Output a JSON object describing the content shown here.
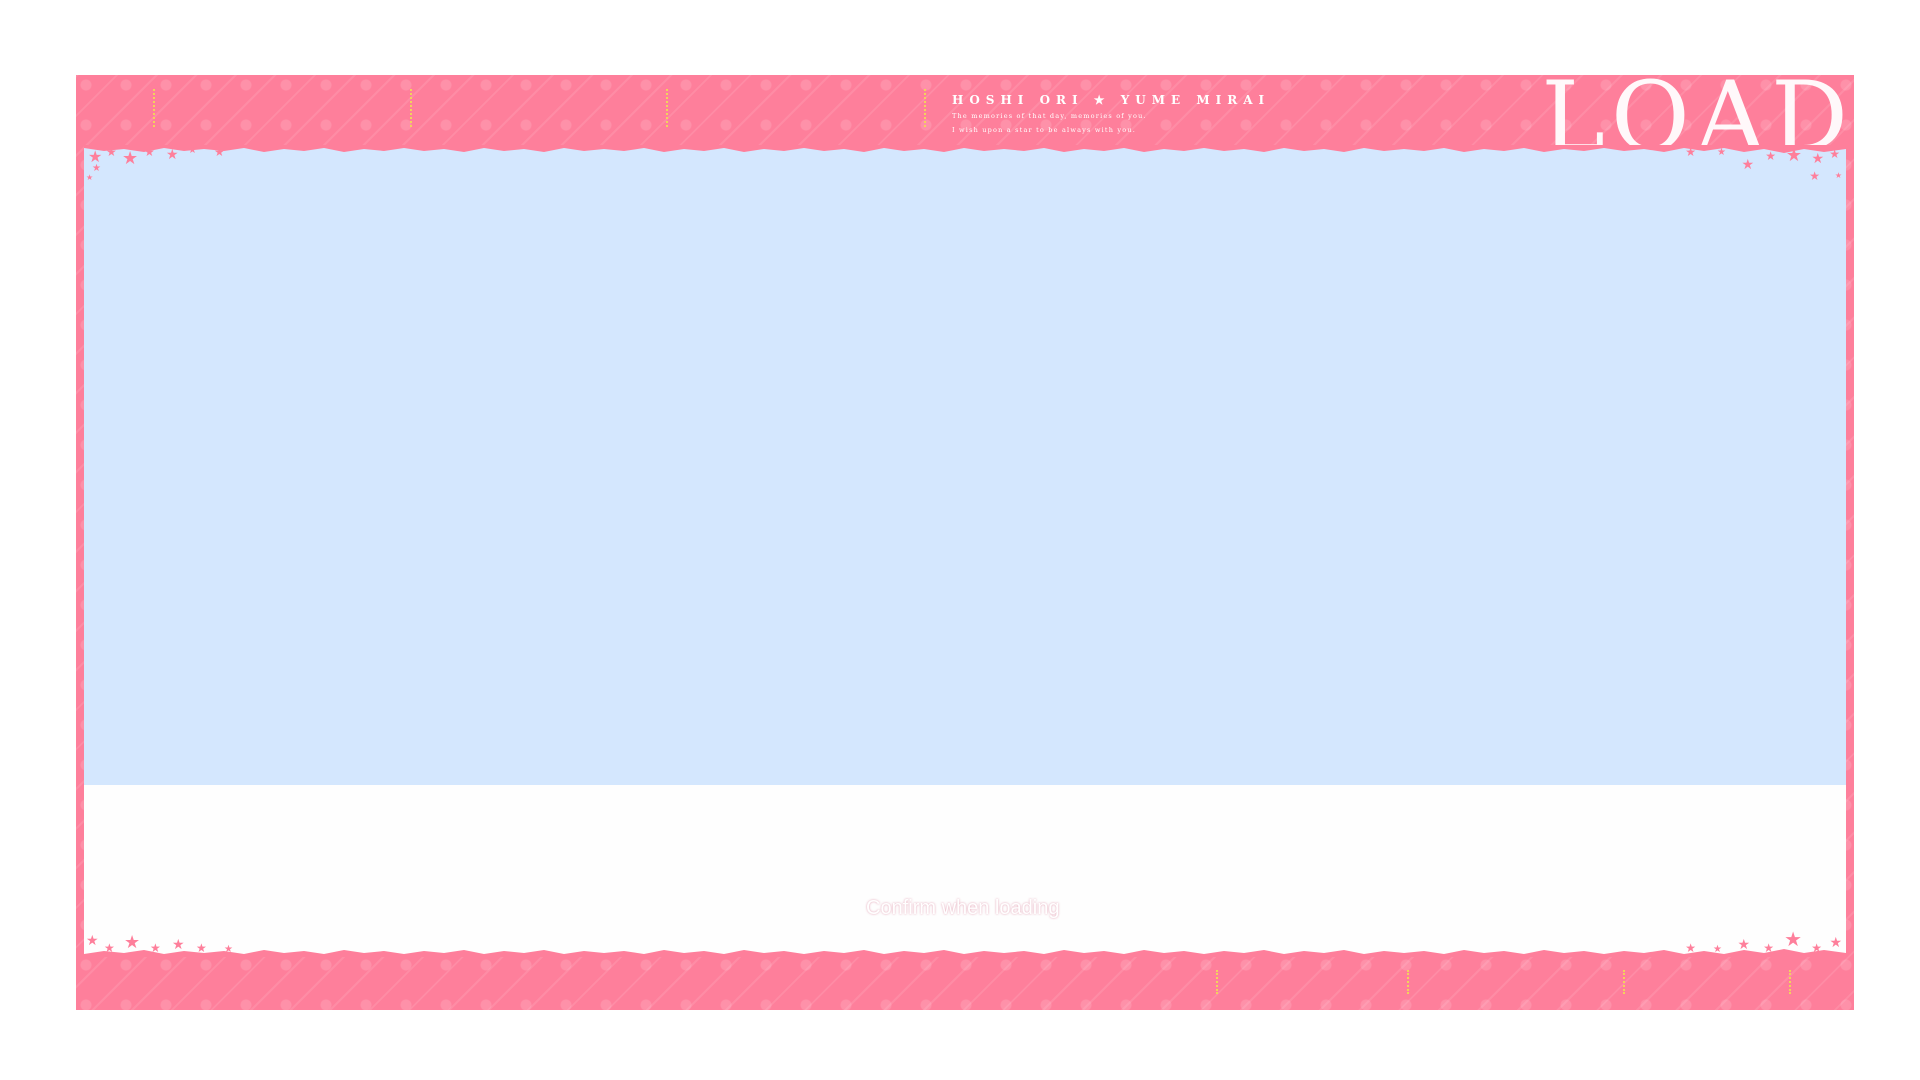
{
  "header": {
    "brand_title": "HOSHI ORI ★ YUME MIRAI",
    "brand_sub_1": "The memories of that day, memories of you.",
    "brand_sub_2": "I wish upon a star to be always with you.",
    "screen_title": "LOAD"
  },
  "footer": {
    "confirm_label": "Confirm when loading"
  },
  "colors": {
    "frame_pink": "#fe7f9b",
    "preview_blue": "#d4e7fe",
    "dots_yellow": "#f2d35b"
  }
}
